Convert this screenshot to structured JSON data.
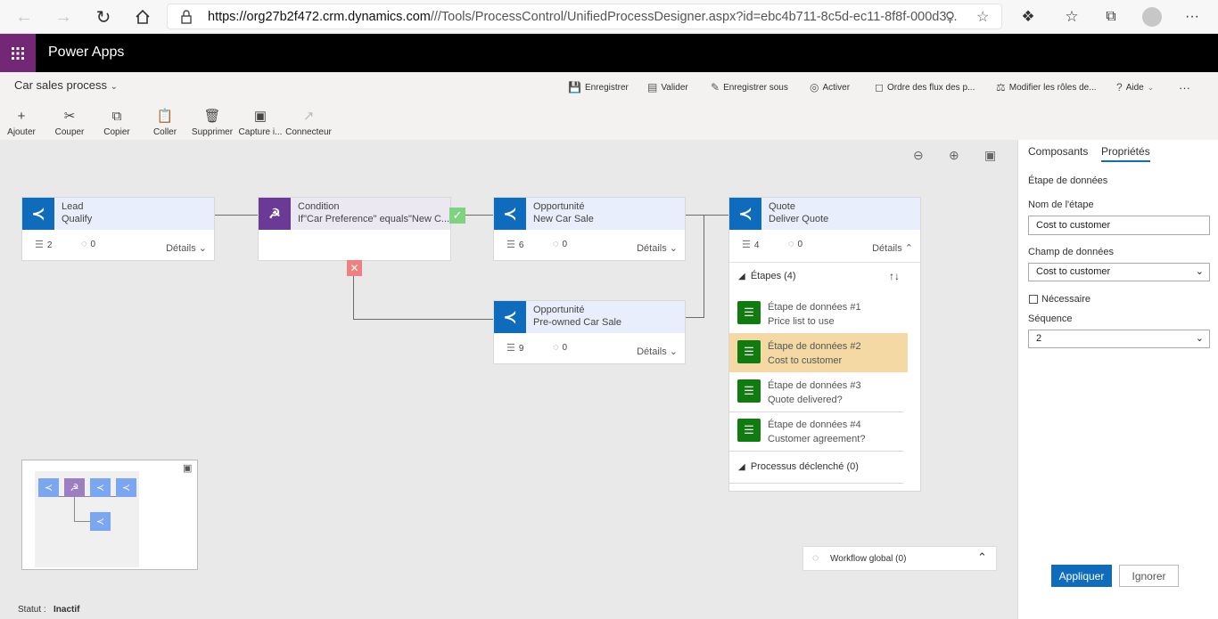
{
  "browser": {
    "url_domain": "https://org27b2f472.crm.dynamics.com",
    "url_path": "///Tools/ProcessControl/UnifiedProcessDesigner.aspx?id=ebc4b711-8c5d-ec11-8f8f-000d3..."
  },
  "app": {
    "title": "Power Apps"
  },
  "process": {
    "name": "Car sales process"
  },
  "commands": {
    "save": "Enregistrer",
    "validate": "Valider",
    "save_as": "Enregistrer sous",
    "activate": "Activer",
    "flow_order": "Ordre des flux des p...",
    "edit_roles": "Modifier les rôles de...",
    "help": "Aide",
    "more": "···"
  },
  "toolbar": {
    "add": "Ajouter",
    "cut": "Couper",
    "copy": "Copier",
    "paste": "Coller",
    "delete": "Supprimer",
    "capture": "Capture i...",
    "connector": "Connecteur"
  },
  "stages": {
    "lead": {
      "entity": "Lead",
      "name": "Qualify",
      "steps": "2",
      "workflows": "0",
      "details": "Détails"
    },
    "condition": {
      "label": "Condition",
      "expr": "If\"Car Preference\" equals\"New C..."
    },
    "opp_new": {
      "entity": "Opportunité",
      "name": "New Car Sale",
      "steps": "6",
      "workflows": "0",
      "details": "Détails"
    },
    "opp_pre": {
      "entity": "Opportunité",
      "name": "Pre-owned Car Sale",
      "steps": "9",
      "workflows": "0",
      "details": "Détails"
    },
    "quote": {
      "entity": "Quote",
      "name": "Deliver Quote",
      "steps": "4",
      "workflows": "0",
      "details": "Détails"
    }
  },
  "quote_steps": {
    "header": "Étapes (4)",
    "items": [
      {
        "title": "Étape de données #1",
        "field": "Price list to use"
      },
      {
        "title": "Étape de données #2",
        "field": "Cost to customer"
      },
      {
        "title": "Étape de données #3",
        "field": "Quote delivered?"
      },
      {
        "title": "Étape de données #4",
        "field": "Customer agreement?"
      }
    ],
    "triggered": "Processus déclenché (0)"
  },
  "global_workflow": "Workflow global (0)",
  "status": {
    "label": "Statut :",
    "value": "Inactif"
  },
  "panel": {
    "tab_components": "Composants",
    "tab_properties": "Propriétés",
    "section_title": "Étape de données",
    "step_name_label": "Nom de l'étape",
    "step_name_value": "Cost to customer",
    "data_field_label": "Champ de données",
    "data_field_value": "Cost to customer",
    "required_label": "Nécessaire",
    "sequence_label": "Séquence",
    "sequence_value": "2",
    "apply": "Appliquer",
    "ignore": "Ignorer"
  },
  "colors": {
    "accent": "#0f6cbd",
    "app_purple": "#742774",
    "condition_purple": "#6b3a96",
    "step_green": "#107c10",
    "selected": "#f4d9a5"
  },
  "icons": [
    "back-icon",
    "forward-icon",
    "refresh-icon",
    "home-icon",
    "lock-icon",
    "zoom-icon",
    "favorite-add-icon",
    "extensions-icon",
    "favorites-icon",
    "collections-icon",
    "profile-icon",
    "more-icon",
    "waffle-icon",
    "stage-icon",
    "condition-icon",
    "check-icon",
    "close-icon",
    "zoom-out-icon",
    "zoom-in-icon",
    "fit-icon",
    "expand-icon"
  ]
}
